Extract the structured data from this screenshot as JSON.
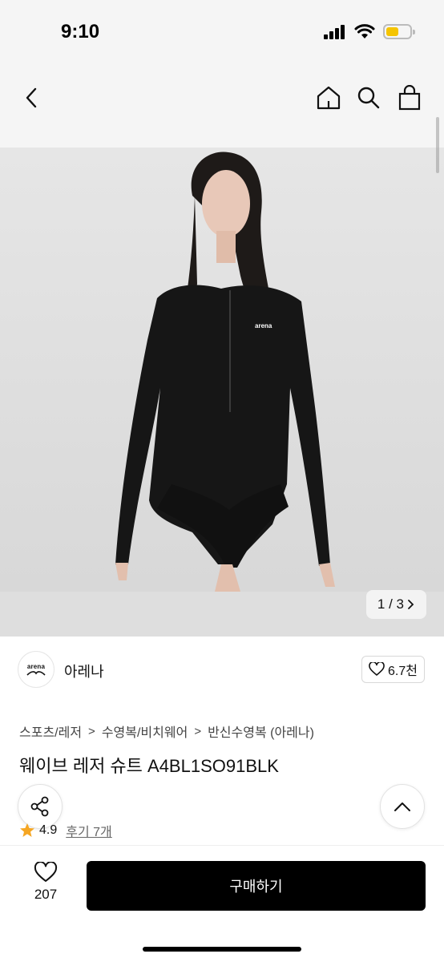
{
  "status_bar": {
    "time": "9:10",
    "battery_color": "#f5c400"
  },
  "nav": {
    "back_icon": "chevron-left-icon",
    "home_icon": "home-icon",
    "search_icon": "search-icon",
    "bag_icon": "shopping-bag-icon"
  },
  "gallery": {
    "counter": "1 / 3"
  },
  "brand": {
    "logo_text": "arena",
    "name": "아레나",
    "likes": "6.7천"
  },
  "breadcrumb": [
    "스포츠/레저",
    "수영복/비치웨어",
    "반신수영복 (아레나)"
  ],
  "product": {
    "title": "웨이브 레저 슈트 A4BL1SO91BLK"
  },
  "rating": {
    "value": "4.9",
    "reviews": "후기 7개",
    "star_color": "#f5a623"
  },
  "bottom_bar": {
    "wish_count": "207",
    "buy_label": "구매하기"
  }
}
